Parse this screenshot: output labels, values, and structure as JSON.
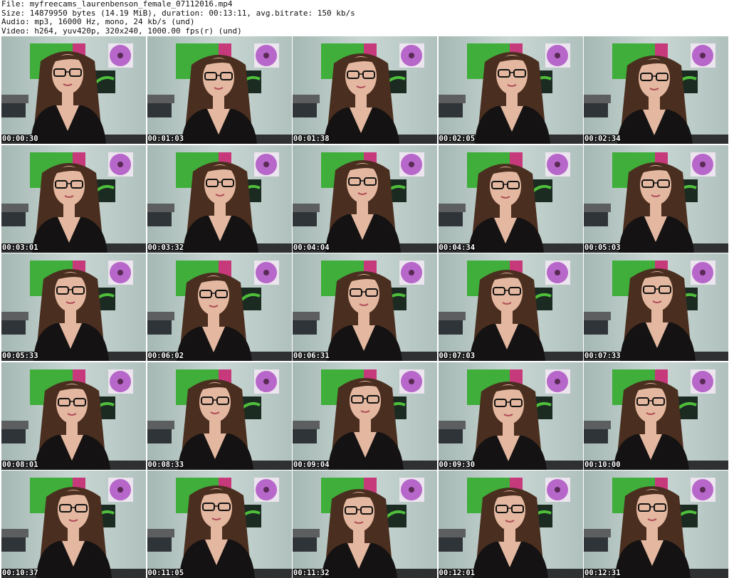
{
  "header": {
    "file_line": "File: myfreecams_laurenbenson_female_07112016.mp4",
    "size_line": "Size: 14879950 bytes (14.19 MiB), duration: 00:13:11, avg.bitrate: 150 kb/s",
    "audio_line": "Audio: mp3, 16000 Hz, mono, 24 kb/s (und)",
    "video_line": "Video: h264, yuv420p, 320x240, 1000.00 fps(r) (und)"
  },
  "thumbnails": [
    {
      "timestamp": "00:00:30"
    },
    {
      "timestamp": "00:01:03"
    },
    {
      "timestamp": "00:01:38"
    },
    {
      "timestamp": "00:02:05"
    },
    {
      "timestamp": "00:02:34"
    },
    {
      "timestamp": "00:03:01"
    },
    {
      "timestamp": "00:03:32"
    },
    {
      "timestamp": "00:04:04"
    },
    {
      "timestamp": "00:04:34"
    },
    {
      "timestamp": "00:05:03"
    },
    {
      "timestamp": "00:05:33"
    },
    {
      "timestamp": "00:06:02"
    },
    {
      "timestamp": "00:06:31"
    },
    {
      "timestamp": "00:07:03"
    },
    {
      "timestamp": "00:07:33"
    },
    {
      "timestamp": "00:08:01"
    },
    {
      "timestamp": "00:08:33"
    },
    {
      "timestamp": "00:09:04"
    },
    {
      "timestamp": "00:09:30"
    },
    {
      "timestamp": "00:10:00"
    },
    {
      "timestamp": "00:10:37"
    },
    {
      "timestamp": "00:11:05"
    },
    {
      "timestamp": "00:11:32"
    },
    {
      "timestamp": "00:12:01"
    },
    {
      "timestamp": "00:12:31"
    }
  ],
  "colors": {
    "page_background": "#ffffff",
    "header_text": "#111111",
    "wall": "#b9cac6",
    "green_poster": "#3fae3a",
    "pink_poster": "#c63a7c",
    "purple_flower": "#b667c9",
    "hair": "#4a2e1f",
    "skin": "#e4b8a0",
    "top": "#141212",
    "timestamp_text": "#ffffff"
  }
}
